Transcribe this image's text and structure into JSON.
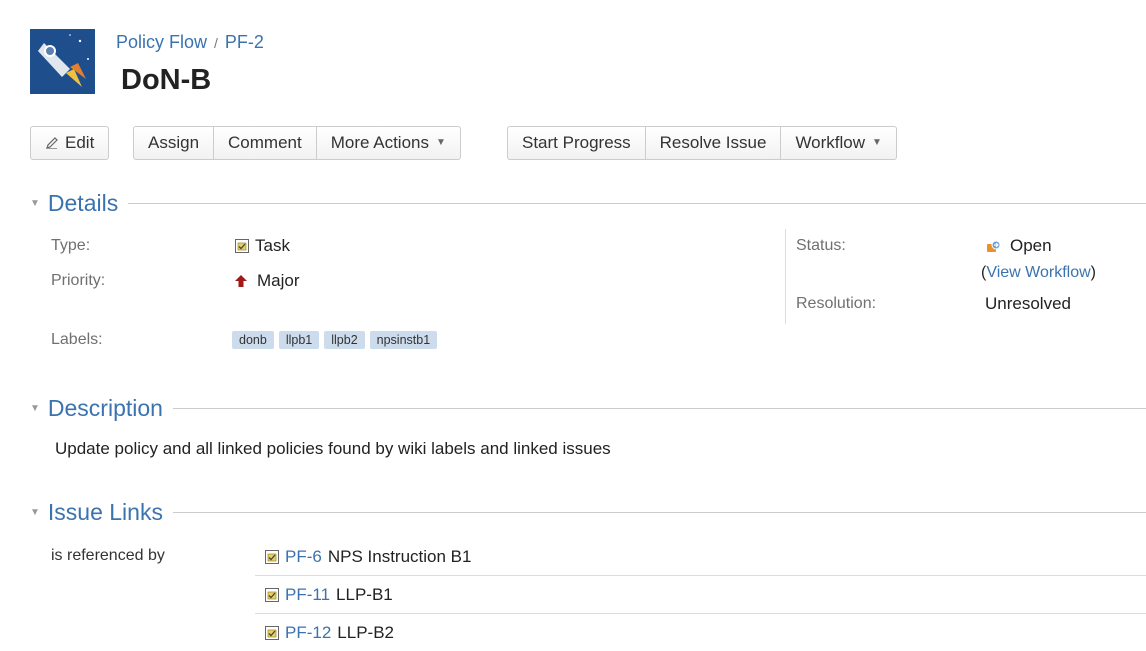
{
  "breadcrumb": {
    "project": "Policy Flow",
    "separator": "/",
    "issue_key": "PF-2"
  },
  "issue": {
    "title": "DoN-B"
  },
  "toolbar": {
    "group1": [
      "Edit"
    ],
    "group2": [
      "Assign",
      "Comment",
      "More Actions"
    ],
    "group3": [
      "Start Progress",
      "Resolve Issue",
      "Workflow"
    ]
  },
  "details": {
    "heading": "Details",
    "type_label": "Type:",
    "type_value": "Task",
    "priority_label": "Priority:",
    "priority_value": "Major",
    "labels_label": "Labels:",
    "labels": [
      "donb",
      "llpb1",
      "llpb2",
      "npsinstb1"
    ],
    "status_label": "Status:",
    "status_value": "Open",
    "view_workflow_open": "(",
    "view_workflow": "View Workflow",
    "view_workflow_close": ")",
    "resolution_label": "Resolution:",
    "resolution_value": "Unresolved"
  },
  "description": {
    "heading": "Description",
    "text": "Update policy and all linked policies found by wiki labels and linked issues"
  },
  "issue_links": {
    "heading": "Issue Links",
    "relation": "is referenced by",
    "items": [
      {
        "key": "PF-6",
        "summary": "NPS Instruction B1"
      },
      {
        "key": "PF-11",
        "summary": "LLP-B1"
      },
      {
        "key": "PF-12",
        "summary": "LLP-B2"
      }
    ]
  },
  "icons": {
    "avatar": "rocket-avatar-icon",
    "edit": "pencil-icon",
    "type": "task-icon",
    "priority": "priority-major-icon",
    "status": "status-open-icon",
    "twisty": "collapse-triangle-icon"
  },
  "colors": {
    "link": "#3b73af",
    "label_bg": "#ccdcec",
    "avatar_bg": "#1f4e8c",
    "priority": "#a01818"
  }
}
